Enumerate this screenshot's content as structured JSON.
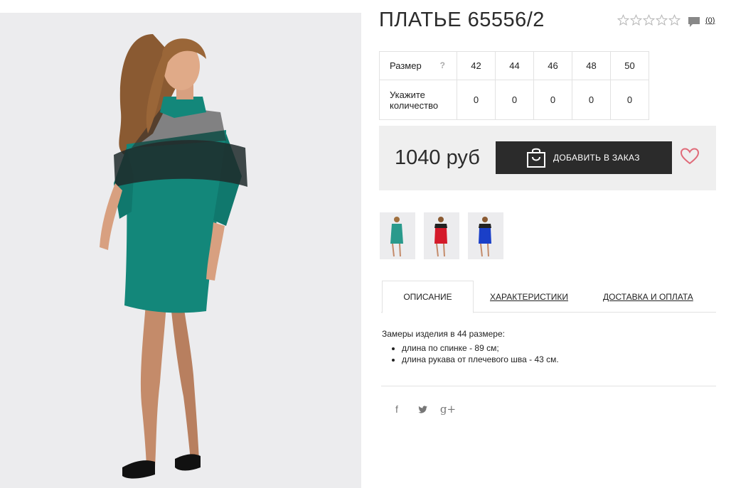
{
  "product": {
    "title": "ПЛАТЬЕ 65556/2",
    "rating_stars": 5,
    "rating_filled": 0,
    "reviews_count": "(0)"
  },
  "size_table": {
    "size_label": "Размер",
    "help_mark": "?",
    "sizes": [
      "42",
      "44",
      "46",
      "48",
      "50"
    ],
    "qty_label_line1": "Укажите",
    "qty_label_line2": "количество",
    "quantities": [
      "0",
      "0",
      "0",
      "0",
      "0"
    ]
  },
  "buy": {
    "price": "1040 руб",
    "add_button": "ДОБАВИТЬ В ЗАКАЗ"
  },
  "thumbnails": [
    {
      "color": "teal",
      "dress_hex": "#2a9a8c"
    },
    {
      "color": "red",
      "dress_hex": "#d41a2a"
    },
    {
      "color": "blue",
      "dress_hex": "#1a3fc8"
    }
  ],
  "tabs": [
    {
      "label": "ОПИСАНИЕ",
      "active": true
    },
    {
      "label": "ХАРАКТЕРИСТИКИ",
      "active": false
    },
    {
      "label": "ДОСТАВКА И ОПЛАТА",
      "active": false
    }
  ],
  "description": {
    "intro": "Замеры изделия в 44 размере:",
    "items": [
      "длина по спинке - 89 см;",
      "длина рукава от плечевого шва - 43 см."
    ]
  },
  "social": {
    "facebook": "f",
    "twitter": "t",
    "googleplus": "g+"
  },
  "colors": {
    "dress": "#13877a",
    "accent_heart": "#e06a78",
    "button": "#2b2b2b",
    "panel": "#efefef"
  }
}
